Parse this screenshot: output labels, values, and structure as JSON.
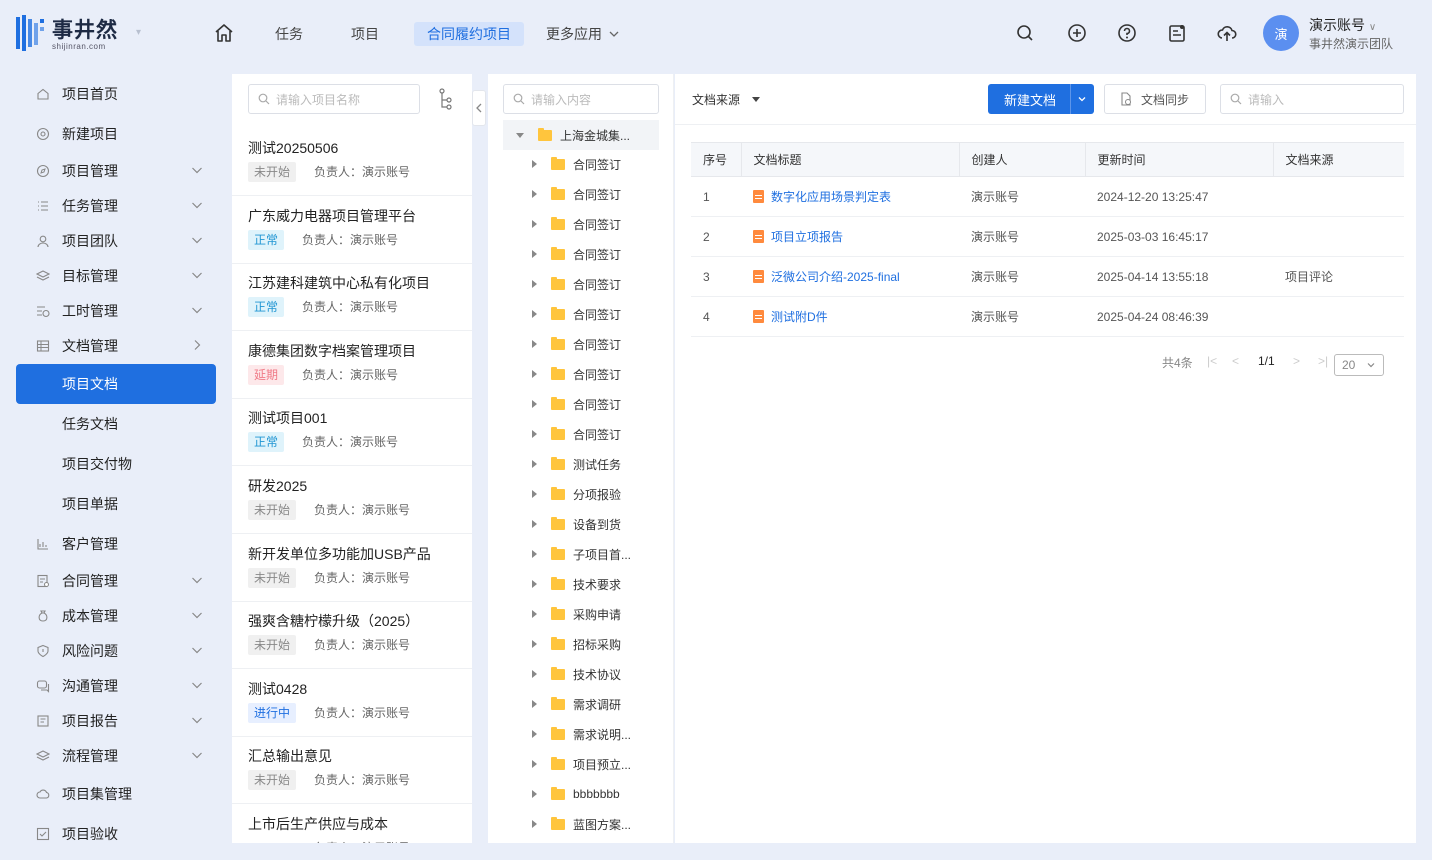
{
  "brand": {
    "name": "事井然",
    "domain": "shijinran.com"
  },
  "topnav": {
    "items": [
      "任务",
      "项目",
      "合同履约项目",
      "更多应用"
    ],
    "active_index": 2
  },
  "user": {
    "avatar": "演",
    "name": "演示账号",
    "team": "事井然演示团队"
  },
  "sidebar": {
    "items": [
      {
        "label": "项目首页",
        "icon": "home-outline-icon"
      },
      {
        "label": "新建项目",
        "icon": "at-icon"
      },
      {
        "label": "项目管理",
        "icon": "compass-icon",
        "expandable": true
      },
      {
        "label": "任务管理",
        "icon": "list-icon",
        "expandable": true
      },
      {
        "label": "项目团队",
        "icon": "user-icon",
        "expandable": true
      },
      {
        "label": "目标管理",
        "icon": "layers-icon",
        "expandable": true
      },
      {
        "label": "工时管理",
        "icon": "timesheet-icon",
        "expandable": true
      },
      {
        "label": "文档管理",
        "icon": "table-icon",
        "expandable": true
      },
      {
        "label": "项目文档",
        "sub": true,
        "active": true
      },
      {
        "label": "任务文档",
        "sub": true
      },
      {
        "label": "项目交付物",
        "sub": true
      },
      {
        "label": "项目单据",
        "sub": true
      },
      {
        "label": "客户管理",
        "icon": "chart-icon"
      },
      {
        "label": "合同管理",
        "icon": "contract-icon",
        "expandable": true
      },
      {
        "label": "成本管理",
        "icon": "moneybag-icon",
        "expandable": true
      },
      {
        "label": "风险问题",
        "icon": "shield-icon",
        "expandable": true
      },
      {
        "label": "沟通管理",
        "icon": "chat-icon",
        "expandable": true
      },
      {
        "label": "项目报告",
        "icon": "report-icon",
        "expandable": true
      },
      {
        "label": "流程管理",
        "icon": "layers-icon",
        "expandable": true
      },
      {
        "label": "项目集管理",
        "icon": "cloud-icon"
      },
      {
        "label": "项目验收",
        "icon": "checkbox-icon"
      }
    ]
  },
  "projects": {
    "search_placeholder": "请输入项目名称",
    "owner_prefix": "负责人：",
    "items": [
      {
        "title": "测试20250506",
        "status": "未开始",
        "status_type": "notstart",
        "owner": "演示账号"
      },
      {
        "title": "广东威力电器项目管理平台",
        "status": "正常",
        "status_type": "normal",
        "owner": "演示账号"
      },
      {
        "title": "江苏建科建筑中心私有化项目",
        "status": "正常",
        "status_type": "normal",
        "owner": "演示账号"
      },
      {
        "title": "康德集团数字档案管理项目",
        "status": "延期",
        "status_type": "delay",
        "owner": "演示账号"
      },
      {
        "title": "测试项目001",
        "status": "正常",
        "status_type": "normal",
        "owner": "演示账号"
      },
      {
        "title": "研发2025",
        "status": "未开始",
        "status_type": "notstart",
        "owner": "演示账号"
      },
      {
        "title": "新开发单位多功能加USB产品",
        "status": "未开始",
        "status_type": "notstart",
        "owner": "演示账号"
      },
      {
        "title": "强爽含糖柠檬升级（2025）",
        "status": "未开始",
        "status_type": "notstart",
        "owner": "演示账号"
      },
      {
        "title": "测试0428",
        "status": "进行中",
        "status_type": "progress",
        "owner": "演示账号"
      },
      {
        "title": "汇总输出意见",
        "status": "未开始",
        "status_type": "notstart",
        "owner": "演示账号"
      },
      {
        "title": "上市后生产供应与成本",
        "status": "",
        "status_type": "notstart",
        "owner": "演示账号"
      }
    ]
  },
  "tree": {
    "search_placeholder": "请输入内容",
    "root": "上海金城集...",
    "children": [
      "合同签订",
      "合同签订",
      "合同签订",
      "合同签订",
      "合同签订",
      "合同签订",
      "合同签订",
      "合同签订",
      "合同签订",
      "合同签订",
      "测试任务",
      "分项报验",
      "设备到货",
      "子项目首...",
      "技术要求",
      "采购申请",
      "招标采购",
      "技术协议",
      "需求调研",
      "需求说明...",
      "项目预立...",
      "bbbbbbb",
      "蓝图方案..."
    ]
  },
  "docs": {
    "source_filter": "文档来源",
    "new_button": "新建文档",
    "sync_button": "文档同步",
    "search_placeholder": "请输入",
    "columns": [
      "序号",
      "文档标题",
      "创建人",
      "更新时间",
      "文档来源"
    ],
    "rows": [
      {
        "no": "1",
        "title": "数字化应用场景判定表",
        "creator": "演示账号",
        "updated": "2024-12-20 13:25:47",
        "source": ""
      },
      {
        "no": "2",
        "title": "项目立项报告",
        "creator": "演示账号",
        "updated": "2025-03-03 16:45:17",
        "source": ""
      },
      {
        "no": "3",
        "title": "泛微公司介绍-2025-final",
        "creator": "演示账号",
        "updated": "2025-04-14 13:55:18",
        "source": "项目评论"
      },
      {
        "no": "4",
        "title": "测试附D件",
        "creator": "演示账号",
        "updated": "2025-04-24 08:46:39",
        "source": ""
      }
    ],
    "pager": {
      "total": "共4条",
      "page": "1/1",
      "page_size": "20"
    }
  },
  "colors": {
    "primary": "#1f6fe0",
    "bg": "#e9eef9"
  }
}
